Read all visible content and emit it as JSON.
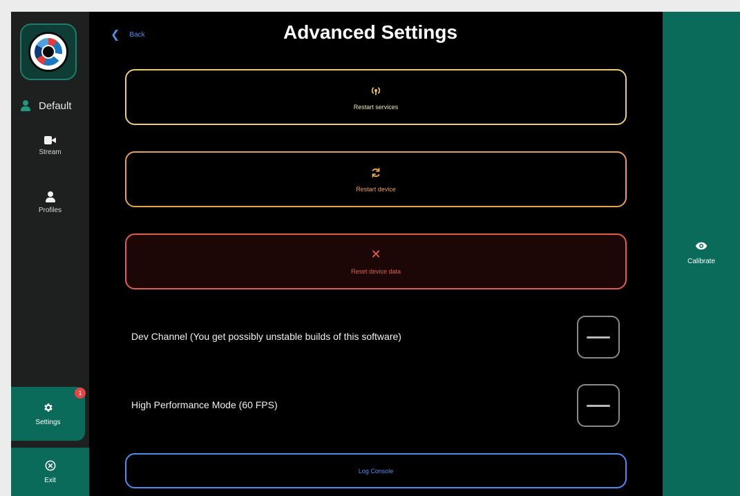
{
  "header": {
    "back_label": "Back",
    "title": "Advanced Settings"
  },
  "sidebar": {
    "profile_name": "Default",
    "nav": [
      {
        "label": "Stream",
        "icon": "camera-icon"
      },
      {
        "label": "Profiles",
        "icon": "person-icon"
      }
    ],
    "settings": {
      "label": "Settings",
      "icon": "gear-icon",
      "badge": "1"
    },
    "exit": {
      "label": "Exit",
      "icon": "close-circle-icon"
    }
  },
  "actions": {
    "restart_services": "Restart services",
    "restart_device": "Restart device",
    "reset_device_data": "Reset device data"
  },
  "toggles": {
    "dev_channel": "Dev Channel (You get possibly unstable builds of this software)",
    "high_performance": "High Performance Mode (60 FPS)"
  },
  "log_console": "Log Console",
  "right_panel": {
    "calibrate_label": "Calibrate",
    "icon": "eye-icon"
  },
  "colors": {
    "accent_teal": "#0b6b5a",
    "restart_services": "#e9d06a",
    "restart_device": "#e7a24a",
    "reset_device_data": "#e05d4f",
    "log_console": "#4a8ef2",
    "badge": "#e64545"
  }
}
